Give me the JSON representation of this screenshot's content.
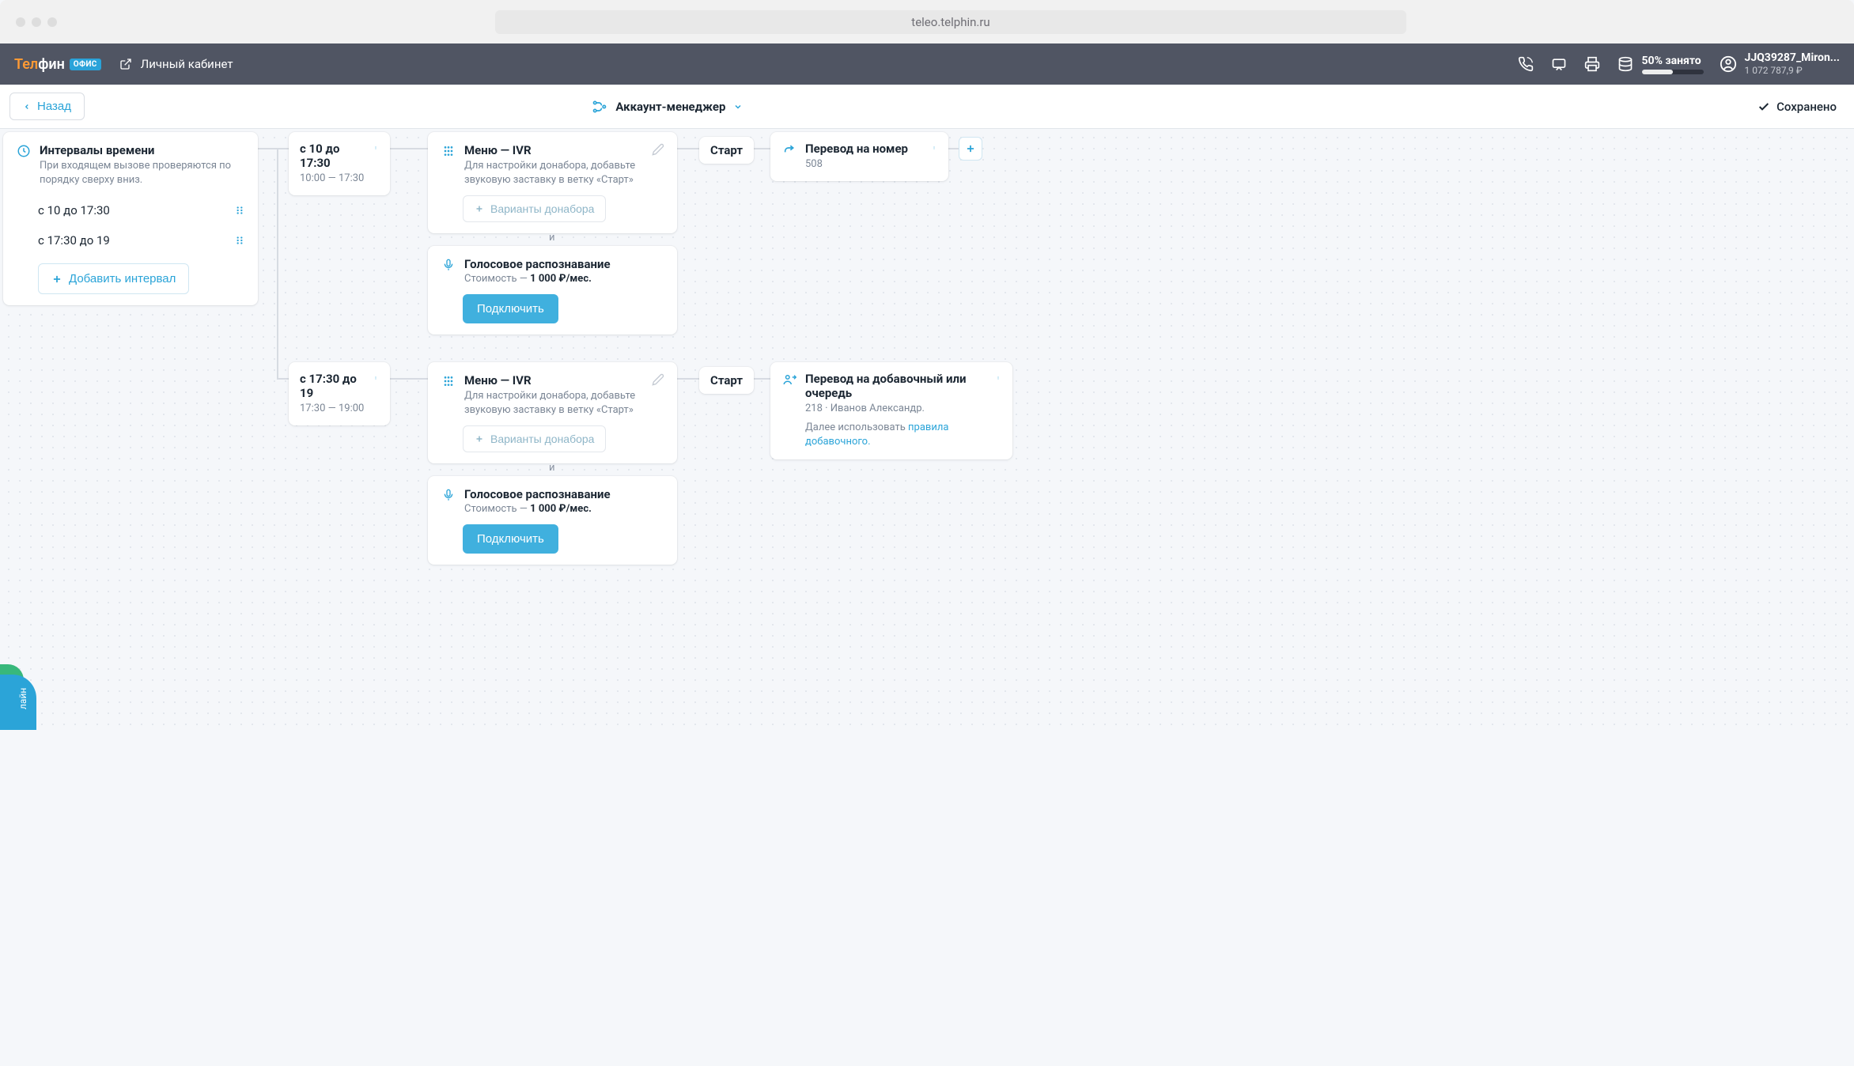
{
  "browser": {
    "url": "teleo.telphin.ru"
  },
  "brand": {
    "name_part1": "Тел",
    "name_part2": "фин",
    "badge": "ОФИС"
  },
  "topbar": {
    "cabinet_link": "Личный кабинет",
    "usage_label": "50% занято",
    "usage_percent": 50,
    "account_name": "JJQ39287_Miron...",
    "account_balance": "1 072 787,9 ₽"
  },
  "subbar": {
    "back_label": "Назад",
    "schema_name": "Аккаунт-менеджер",
    "saved_label": "Сохранено"
  },
  "nodes": {
    "intervals": {
      "title": "Интервалы времени",
      "subtitle": "При входящем вызове проверяются по порядку сверху вниз.",
      "items": [
        "с 10 до 17:30",
        "с 17:30 до 19"
      ],
      "add_label": "Добавить интервал"
    },
    "slot1": {
      "title": "с 10 до 17:30",
      "range": "10:00 — 17:30"
    },
    "slot2": {
      "title": "с 17:30 до 19",
      "range": "17:30 — 19:00"
    },
    "ivr": {
      "title": "Меню — IVR",
      "subtitle": "Для настройки донабора, добавьте звуковую заставку в ветку «Старт»",
      "variants_btn": "Варианты донабора"
    },
    "voice": {
      "title": "Голосовое распознавание",
      "cost_prefix": "Стоимость — ",
      "cost_value": "1 000 ₽/мес.",
      "connect_btn": "Подключить"
    },
    "start": {
      "label": "Старт"
    },
    "transfer_number": {
      "title": "Перевод на номер",
      "value": "508"
    },
    "transfer_ext": {
      "title": "Перевод на добавочный или очередь",
      "value": "218 · Иванов Александр.",
      "next_prefix": "Далее использовать ",
      "next_link": "правила добавочного."
    },
    "and": "и"
  },
  "misc": {
    "online_tab": "лайн"
  }
}
